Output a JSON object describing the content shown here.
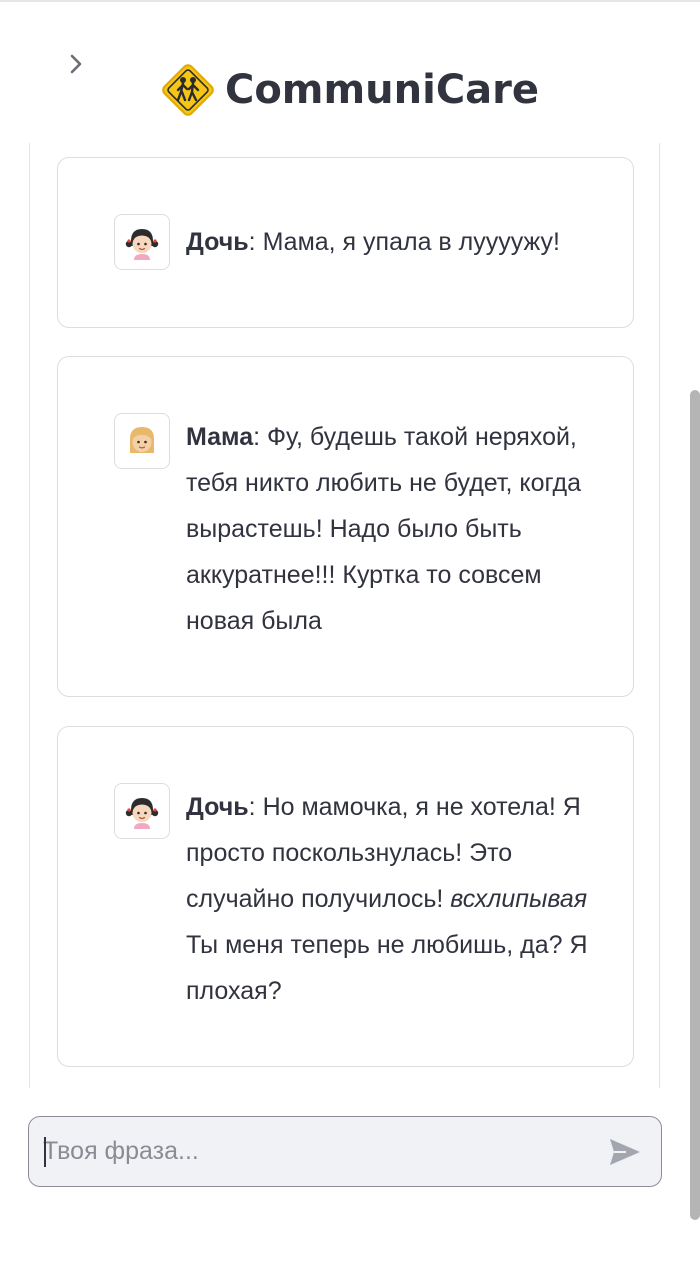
{
  "app": {
    "title": "CommuniCare",
    "logo_icon": "school-crossing-sign-icon",
    "sidebar_toggle_icon": "chevron-right-icon"
  },
  "messages": [
    {
      "speaker": "Дочь",
      "avatar_icon": "girl-icon",
      "separator": ": ",
      "text": "Мама, я упала в луууужу!"
    },
    {
      "speaker": "Мама",
      "avatar_icon": "woman-blonde-icon",
      "separator": ": ",
      "text": "Фу, будешь такой неряхой, тебя никто любить не будет, когда вырастешь! Надо было быть аккуратнее!!! Куртка то совсем новая была"
    },
    {
      "speaker": "Дочь",
      "avatar_icon": "girl-icon",
      "separator": ": ",
      "text_before": "Но мамочка, я не хотела! Я просто поскользнулась! Это случайно получилось! ",
      "action": "всхлипывая",
      "text_after": " Ты меня теперь не любишь, да? Я плохая?"
    }
  ],
  "chat_input": {
    "placeholder": "Твоя фраза...",
    "value": "",
    "send_icon": "send-arrow-icon"
  },
  "colors": {
    "text": "#31333f",
    "border": "#dcdde3",
    "input_bg": "#f0f2f6",
    "placeholder": "#8a8c94",
    "logo_yellow": "#f5c518"
  }
}
